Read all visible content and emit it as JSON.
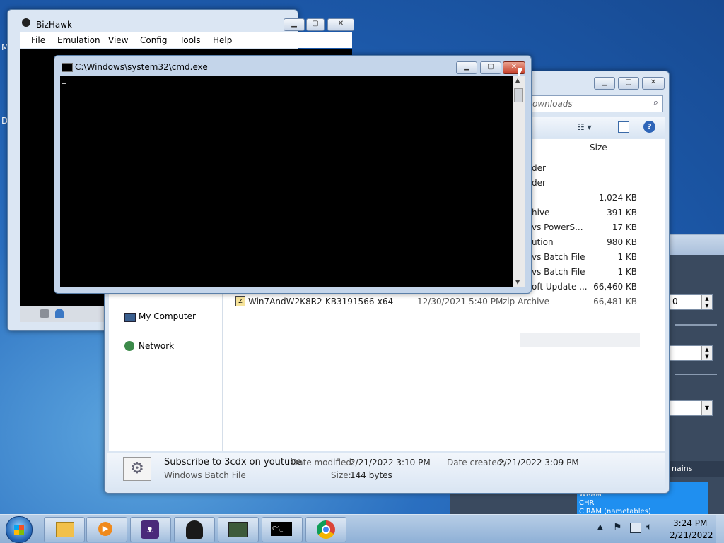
{
  "bizhawk": {
    "title": "BizHawk",
    "menu": [
      "File",
      "Emulation",
      "View",
      "Config",
      "Tools",
      "Help"
    ]
  },
  "cmd": {
    "title": "C:\\Windows\\system32\\cmd.exe"
  },
  "explorer": {
    "search_text": "ownloads",
    "column_size": "Size",
    "rows": [
      {
        "name": "",
        "date": "",
        "type": "der",
        "size": ""
      },
      {
        "name": "",
        "date": "",
        "type": "der",
        "size": ""
      },
      {
        "name": "",
        "date": "",
        "type": "",
        "size": "1,024 KB"
      },
      {
        "name": "",
        "date": "",
        "type": "hive",
        "size": "391 KB"
      },
      {
        "name": "",
        "date": "",
        "type": "vs PowerS...",
        "size": "17 KB"
      },
      {
        "name": "",
        "date": "",
        "type": "ution",
        "size": "980 KB"
      },
      {
        "name": "",
        "date": "",
        "type": "vs Batch File",
        "size": "1 KB"
      },
      {
        "name": "",
        "date": "",
        "type": "vs Batch File",
        "size": "1 KB"
      },
      {
        "name": "",
        "date": "",
        "type": "oft Update ...",
        "size": "66,460 KB"
      },
      {
        "name": "Win7AndW2K8R2-KB3191566-x64",
        "date": "12/30/2021 5:40 PM",
        "type": "zip Archive",
        "size": "66,481 KB"
      }
    ],
    "nav": {
      "my_computer": "My Computer",
      "network": "Network"
    },
    "details": {
      "name": "Subscribe to 3cdx on youtube",
      "kind": "Windows Batch File",
      "modified_label": "Date modified:",
      "modified": "2/21/2022 3:10 PM",
      "created_label": "Date created:",
      "created": "2/21/2022 3:09 PM",
      "size_label": "Size:",
      "size": "144 bytes"
    }
  },
  "right_panel": {
    "field_value": "0",
    "tab": "nains",
    "list": [
      "WRAM",
      "CHR",
      "CIRAM (nametables)"
    ]
  },
  "desktop_labels": [
    "M",
    "D"
  ],
  "taskbar": {
    "time": "3:24 PM",
    "date": "2/21/2022",
    "cmd_label": "C:\\_"
  }
}
